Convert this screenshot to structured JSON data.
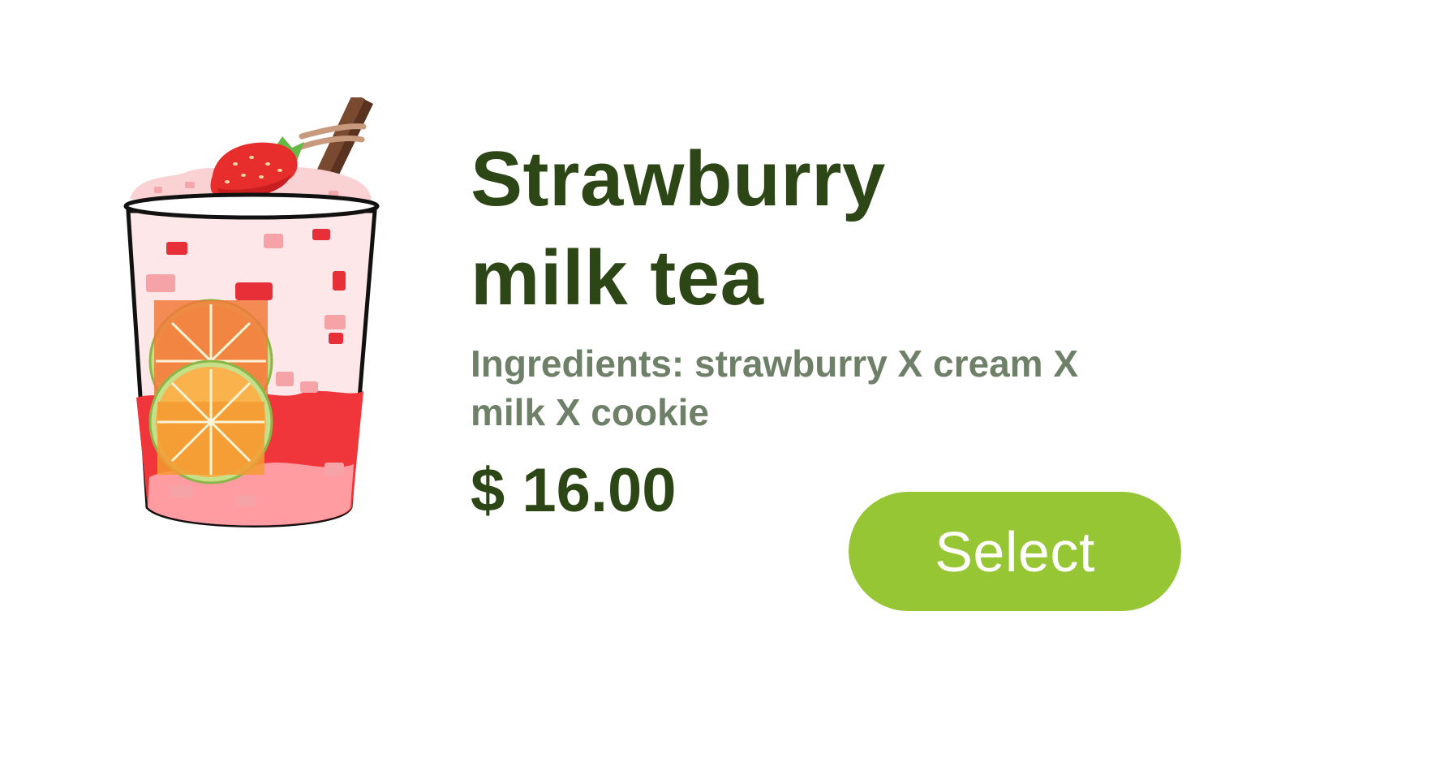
{
  "product": {
    "title_line1": "Strawburry",
    "title_line2": "milk tea",
    "ingredients_line1": "Ingredients: strawburry X cream X",
    "ingredients_line2": "milk X cookie",
    "price": "$ 16.00"
  },
  "actions": {
    "select_label": "Select"
  },
  "illustration": {
    "icon": "strawberry-milk-tea-cup-icon"
  },
  "colors": {
    "title": "#2d4616",
    "ingredients": "#6f8068",
    "price": "#2d4616",
    "button_bg": "#96c633",
    "button_text": "#ffffff"
  }
}
